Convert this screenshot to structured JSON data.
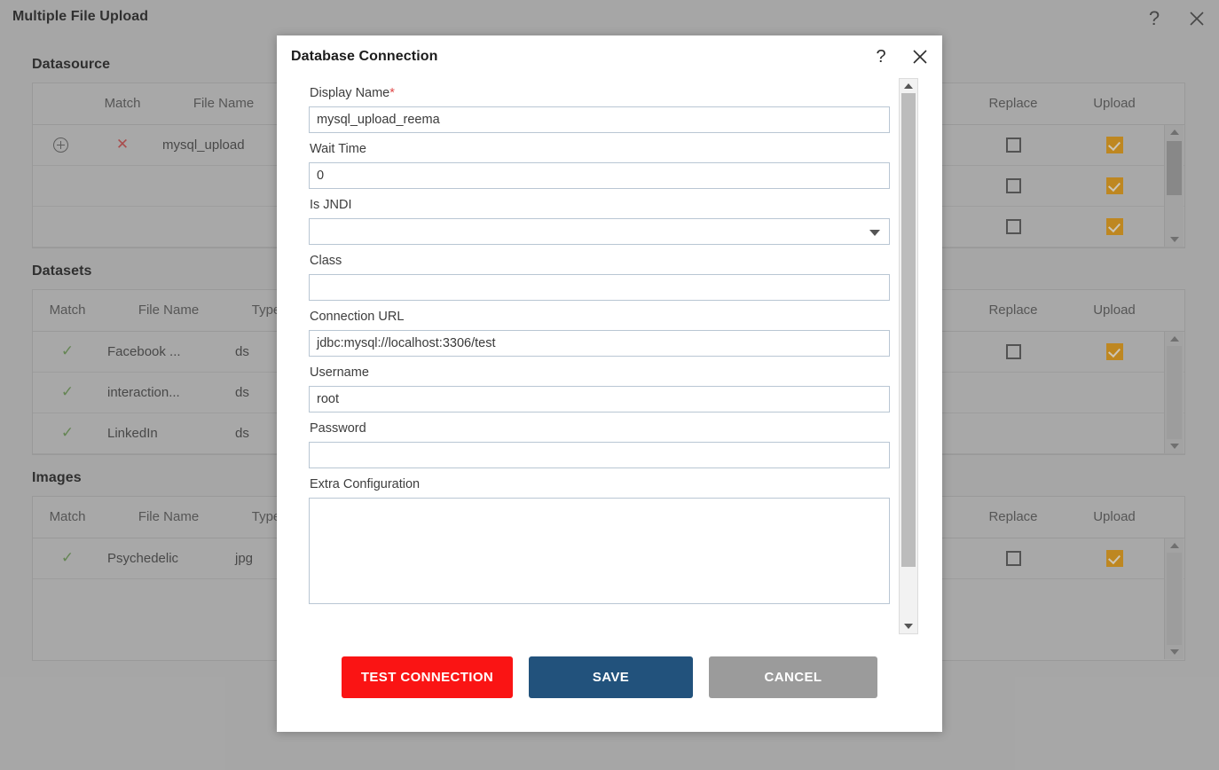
{
  "window": {
    "title": "Multiple File Upload",
    "help_icon": "help-icon",
    "close_icon": "close-icon",
    "help_glyph": "?"
  },
  "sections": [
    {
      "key": "datasource",
      "title": "Datasource",
      "headers": {
        "expand": "",
        "match": "Match",
        "file_name": "File Name",
        "type": "",
        "replace": "Replace",
        "upload": "Upload"
      },
      "rows": [
        {
          "expand": "+",
          "match": "cross",
          "file_name": "mysql_upload",
          "type": "",
          "replace": "unchecked",
          "upload": "checked"
        },
        {
          "expand": "",
          "match": "",
          "file_name": "",
          "type": "",
          "replace": "unchecked",
          "upload": "checked"
        },
        {
          "expand": "",
          "match": "",
          "file_name": "",
          "type": "",
          "replace": "unchecked",
          "upload": "checked"
        }
      ]
    },
    {
      "key": "datasets",
      "title": "Datasets",
      "headers": {
        "match": "Match",
        "file_name": "File Name",
        "type": "Type",
        "replace": "Replace",
        "upload": "Upload"
      },
      "rows": [
        {
          "match": "check",
          "file_name": "Facebook ...",
          "type": "ds",
          "replace": "unchecked",
          "upload": "checked"
        },
        {
          "match": "check",
          "file_name": "interaction...",
          "type": "ds",
          "replace": "",
          "upload": ""
        },
        {
          "match": "check",
          "file_name": "LinkedIn",
          "type": "ds",
          "replace": "",
          "upload": ""
        }
      ]
    },
    {
      "key": "images",
      "title": "Images",
      "headers": {
        "match": "Match",
        "file_name": "File Name",
        "type": "Type",
        "replace": "Replace",
        "upload": "Upload"
      },
      "rows": [
        {
          "match": "check",
          "file_name": "Psychedelic",
          "type": "jpg",
          "replace": "unchecked",
          "upload": "checked"
        }
      ]
    }
  ],
  "modal": {
    "title": "Database Connection",
    "help_glyph": "?",
    "help_icon": "help-icon",
    "close_icon": "close-icon",
    "fields": {
      "display_name": {
        "label": "Display Name",
        "required_marker": "*",
        "value": "mysql_upload_reema"
      },
      "wait_time": {
        "label": "Wait Time",
        "value": "0"
      },
      "is_jndi": {
        "label": "Is JNDI",
        "value": ""
      },
      "class": {
        "label": "Class",
        "value": ""
      },
      "connection_url": {
        "label": "Connection URL",
        "value": "jdbc:mysql://localhost:3306/test"
      },
      "username": {
        "label": "Username",
        "value": "root"
      },
      "password": {
        "label": "Password",
        "value": ""
      },
      "extra_config": {
        "label": "Extra Configuration",
        "value": ""
      }
    },
    "buttons": {
      "test_connection": "TEST CONNECTION",
      "save": "SAVE",
      "cancel": "CANCEL"
    }
  },
  "colors": {
    "page_background": "#b4b4b4",
    "modal_background": "#ffffff",
    "accent_red": "#fa1414",
    "accent_blue": "#22527c",
    "accent_gray": "#9b9b9b",
    "upload_checked": "#d28c0a",
    "match_cross": "#b84343",
    "match_check": "#5f8a4a",
    "required_marker": "#e04b4b"
  }
}
